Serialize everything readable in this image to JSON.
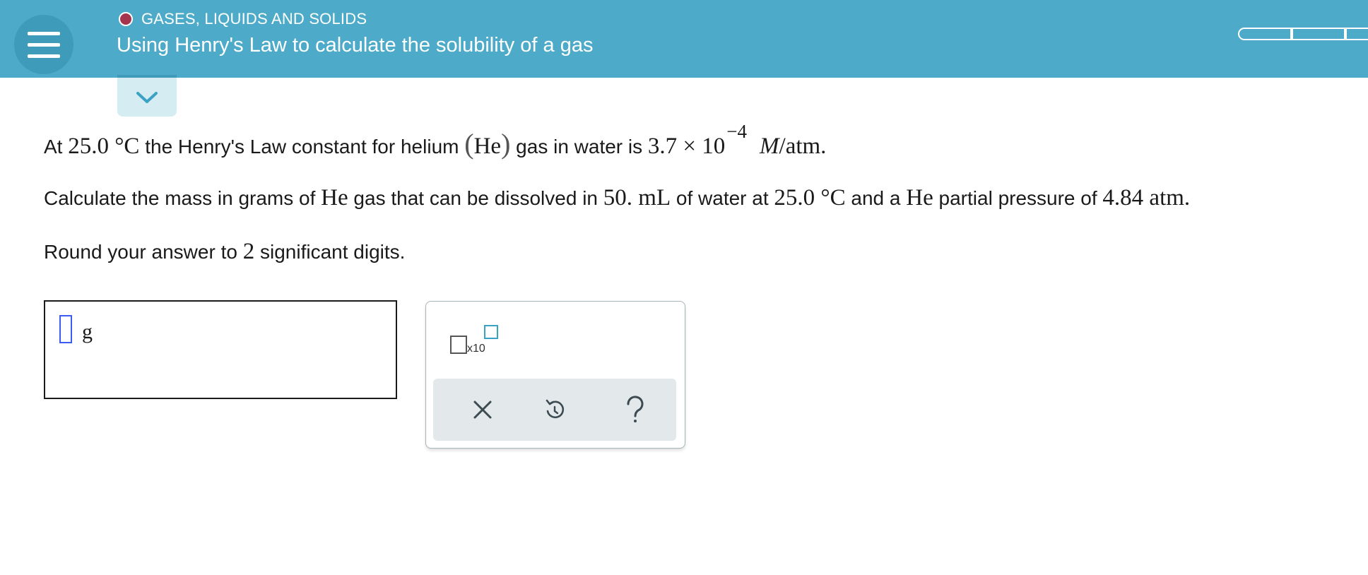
{
  "header": {
    "topic": "GASES, LIQUIDS AND SOLIDS",
    "title": "Using Henry's Law to calculate the solubility of a gas",
    "accent_color": "#4dabc9",
    "topic_dot_color": "#a5344f",
    "menu_icon": "hamburger-icon",
    "progress_segments": 3
  },
  "question": {
    "line1": {
      "t1": "At ",
      "temp": "25.0 °C",
      "t2": " the Henry's Law constant for helium ",
      "paren_open": "(",
      "species": "He",
      "paren_close": ")",
      "t3": " gas in water is ",
      "coef": "3.7 × 10",
      "exp": "−4",
      "unit_m": "M",
      "unit_rest": "/atm."
    },
    "line2": {
      "t1": "Calculate the mass in grams of ",
      "species": "He",
      "t2": " gas that can be dissolved in ",
      "volume": "50. mL",
      "t3": " of water at ",
      "temp": "25.0 °C",
      "t4": " and a ",
      "species2": "He",
      "t5": " partial pressure of ",
      "pressure": "4.84 atm."
    },
    "line3": {
      "t1": "Round your answer to ",
      "digits": "2",
      "t2": " significant digits."
    }
  },
  "answer": {
    "unit": "g"
  },
  "tools": {
    "x10_label": "x10",
    "clear_icon": "close-icon",
    "undo_icon": "undo-icon",
    "help_icon": "question-mark-icon"
  }
}
